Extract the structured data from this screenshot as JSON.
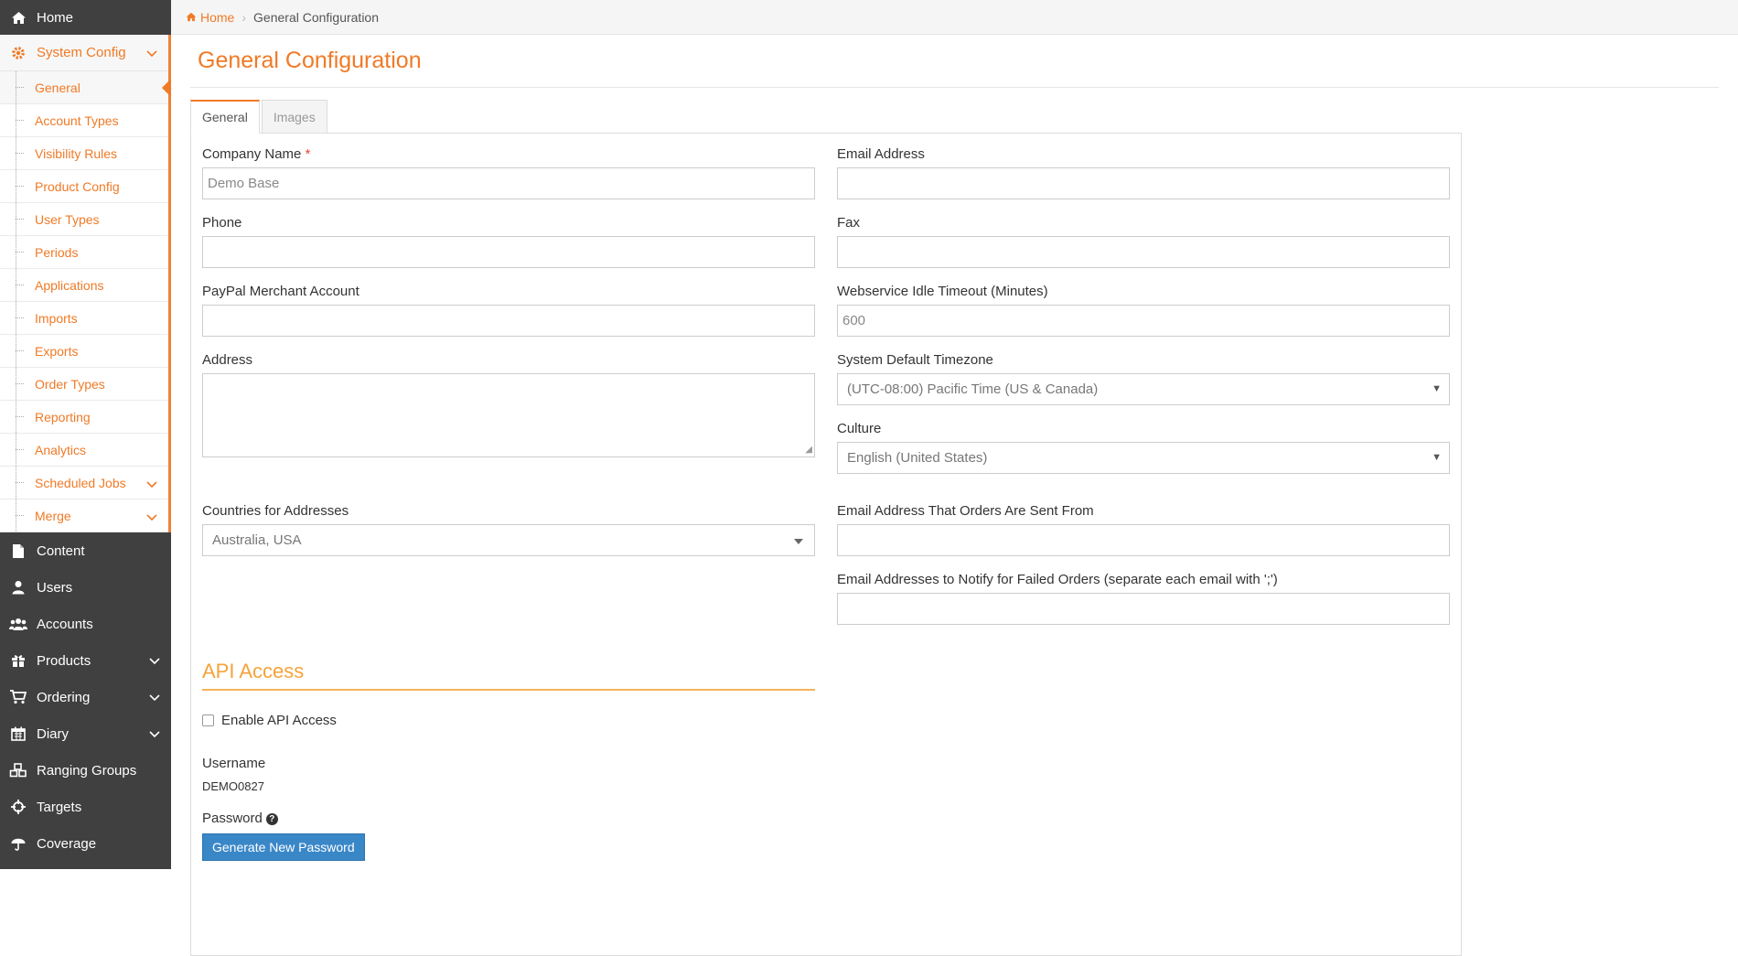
{
  "sidebar": {
    "home": {
      "label": "Home"
    },
    "system_config": {
      "label": "System Config",
      "items": [
        {
          "label": "General"
        },
        {
          "label": "Account Types"
        },
        {
          "label": "Visibility Rules"
        },
        {
          "label": "Product Config"
        },
        {
          "label": "User Types"
        },
        {
          "label": "Periods"
        },
        {
          "label": "Applications"
        },
        {
          "label": "Imports"
        },
        {
          "label": "Exports"
        },
        {
          "label": "Order Types"
        },
        {
          "label": "Reporting"
        },
        {
          "label": "Analytics"
        },
        {
          "label": "Scheduled Jobs"
        },
        {
          "label": "Merge"
        }
      ]
    },
    "items": [
      {
        "label": "Content"
      },
      {
        "label": "Users"
      },
      {
        "label": "Accounts"
      },
      {
        "label": "Products"
      },
      {
        "label": "Ordering"
      },
      {
        "label": "Diary"
      },
      {
        "label": "Ranging Groups"
      },
      {
        "label": "Targets"
      },
      {
        "label": "Coverage"
      }
    ]
  },
  "breadcrumb": {
    "home": "Home",
    "current": "General Configuration"
  },
  "page": {
    "title": "General Configuration"
  },
  "tabs": [
    {
      "label": "General"
    },
    {
      "label": "Images"
    }
  ],
  "form": {
    "company_name": {
      "label": "Company Name",
      "required_mark": "*",
      "value": "Demo Base"
    },
    "email_address": {
      "label": "Email Address",
      "value": ""
    },
    "phone": {
      "label": "Phone",
      "value": ""
    },
    "fax": {
      "label": "Fax",
      "value": ""
    },
    "paypal": {
      "label": "PayPal Merchant Account",
      "value": ""
    },
    "ws_timeout": {
      "label": "Webservice Idle Timeout (Minutes)",
      "value": "600"
    },
    "address": {
      "label": "Address",
      "value": ""
    },
    "timezone": {
      "label": "System Default Timezone",
      "value": "(UTC-08:00) Pacific Time (US & Canada)"
    },
    "culture": {
      "label": "Culture",
      "value": "English (United States)"
    },
    "countries": {
      "label": "Countries for Addresses",
      "value": "Australia, USA"
    },
    "orders_from": {
      "label": "Email Address That Orders Are Sent From",
      "value": ""
    },
    "notify_failed": {
      "label": "Email Addresses to Notify for Failed Orders (separate each email with ';')",
      "value": ""
    }
  },
  "api": {
    "title": "API Access",
    "enable_label": "Enable API Access",
    "username_label": "Username",
    "username_value": "DEMO0827",
    "password_label": "Password",
    "generate_button": "Generate New Password"
  }
}
